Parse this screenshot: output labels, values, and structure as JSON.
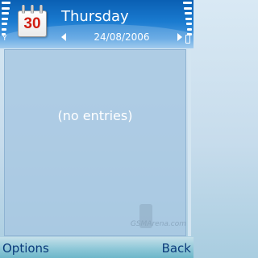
{
  "header": {
    "day_number": "30",
    "weekday": "Thursday",
    "date": "24/08/2006"
  },
  "main": {
    "empty_message": "(no entries)"
  },
  "watermark": {
    "text": "GSMArena.com"
  },
  "softkeys": {
    "left": "Options",
    "right": "Back"
  },
  "icons": {
    "antenna": "antenna-icon",
    "battery": "battery-icon",
    "calendar": "calendar-icon"
  },
  "colors": {
    "header_blue": "#1a7bd0",
    "calendar_red": "#d11e12",
    "softkey_text": "#0a3a7a"
  }
}
